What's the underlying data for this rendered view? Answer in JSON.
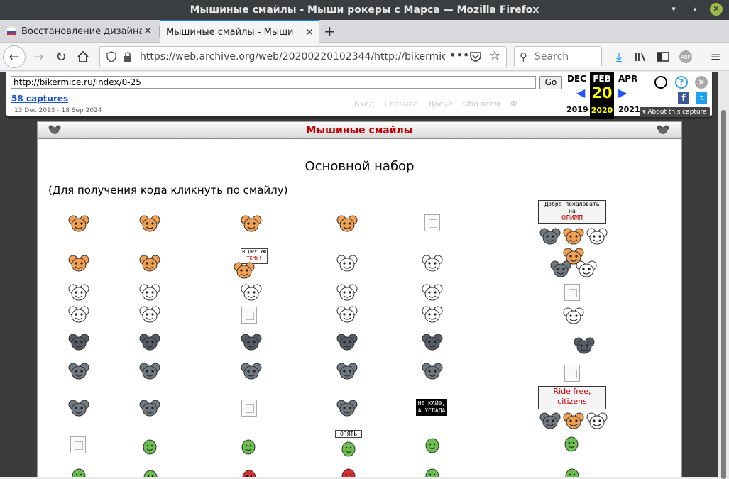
{
  "window": {
    "title": "Мышиные смайлы - Мыши рокеры с Марса — Mozilla Firefox"
  },
  "tabs": [
    {
      "label": "Восстановление дизайна!"
    },
    {
      "label": "Мышиные смайлы - Мыши рокеры с Марса"
    }
  ],
  "navbar": {
    "url": "https://web.archive.org/web/20200220102344/http://bikermice.ru:80/",
    "search_placeholder": "Search"
  },
  "wayback": {
    "url_value": "http://bikermice.ru/index/0-25",
    "go_label": "Go",
    "captures": "58 captures",
    "range": "13 Dec 2013 - 18 Sep 2024",
    "month_prev": "DEC",
    "month_cur": "FEB",
    "month_next": "APR",
    "day": "20",
    "year_prev": "2019",
    "year_cur": "2020",
    "year_next": "2021",
    "about": "About this capture",
    "ghost_menu": [
      "Вход",
      "Главное",
      "Досье",
      "Обо всем",
      "Ф"
    ]
  },
  "site": {
    "header": "Мышиные смайлы",
    "title": "Основной набор",
    "note": "(Для получения кода кликнуть по смайлу)",
    "banner_olymp": [
      "Добро пожаловать",
      "на",
      "ОЛИМП"
    ],
    "banner_ride": [
      "Ride free,",
      "citizens"
    ],
    "sign_other_topic": [
      "В ДРУГУЮ",
      "ТЕМУ!"
    ],
    "sign_ne_kaif": [
      "НЕ КАЙФ,",
      "А УСЛАДА"
    ],
    "sign_opyat": "ОПЯТЬ"
  },
  "colors": {
    "accent": "#0a84ff",
    "header_text": "#c00000",
    "orange_mouse": "#f0a050",
    "gray_mouse": "#707880",
    "green": "#6bbf4e"
  }
}
